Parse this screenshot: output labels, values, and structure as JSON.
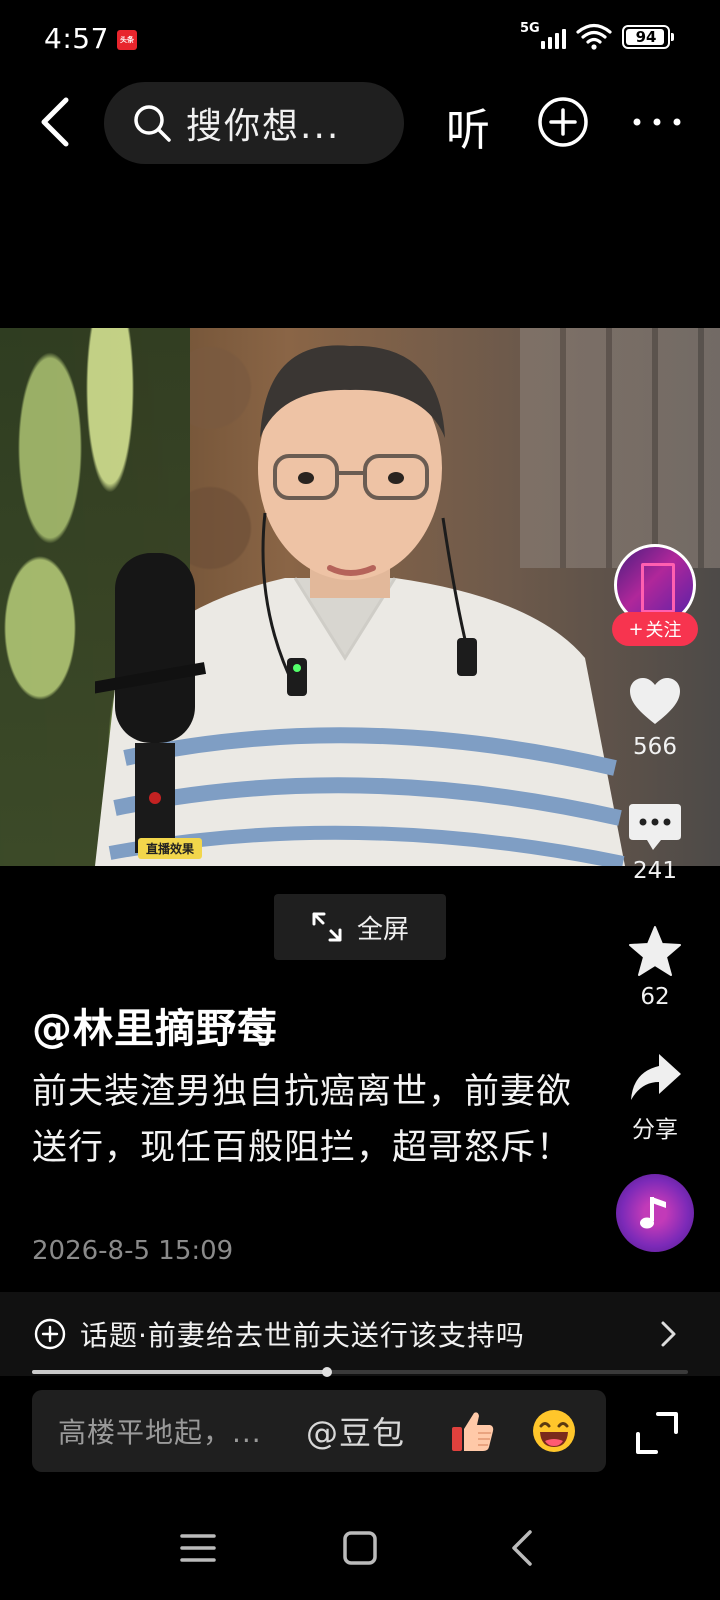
{
  "status_bar": {
    "time": "4:57",
    "app_badge": "头条",
    "network": "5G",
    "battery": "94"
  },
  "top_nav": {
    "search_placeholder": "搜你想...",
    "listen_label": "听"
  },
  "video": {
    "live_tag": "直播效果",
    "fullscreen_label": "全屏"
  },
  "rail": {
    "follow_label": "关注",
    "likes": "566",
    "comments": "241",
    "favorites": "62",
    "share_label": "分享"
  },
  "post": {
    "author": "@林里摘野莓",
    "title": "前夫装渣男独自抗癌离世，前妻欲送行，现任百般阻拦，超哥怒斥！",
    "date": "2026-8-5 15:09"
  },
  "topic": {
    "label": "话题·前妻给去世前夫送行该支持吗",
    "progress": 0.45
  },
  "comment": {
    "placeholder": "高楼平地起，...",
    "mention": "@豆包"
  },
  "colors": {
    "follow_red": "#f7344f",
    "panel_grey": "#1f1f1f"
  }
}
